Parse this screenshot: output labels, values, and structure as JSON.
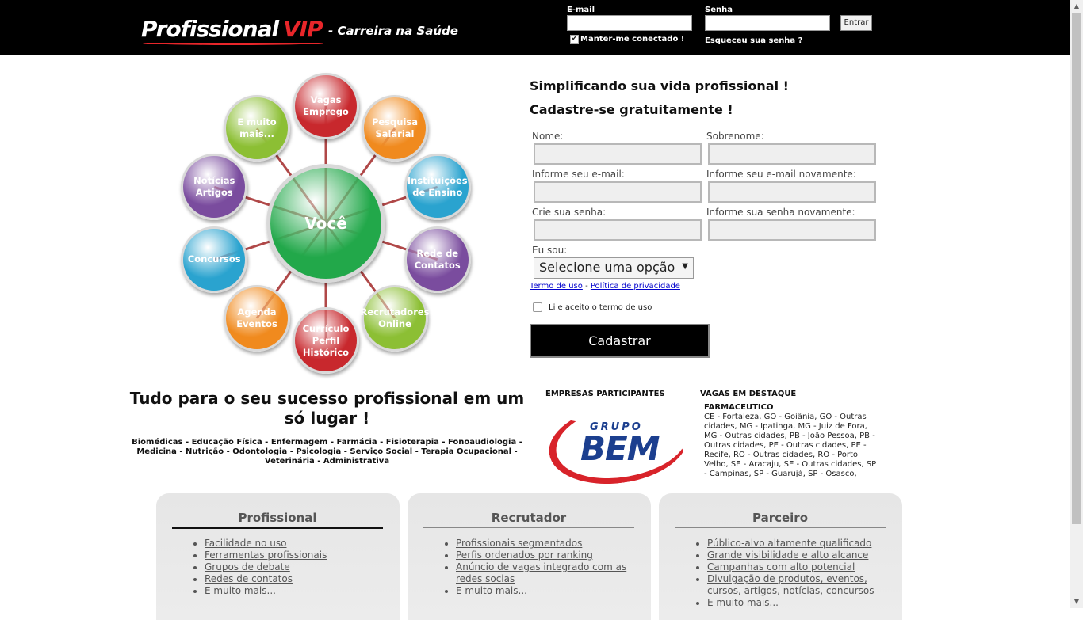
{
  "header": {
    "logo_main": "Profissional",
    "logo_accent": "VIP",
    "tagline": "- Carreira na Saúde",
    "email_label": "E-mail",
    "password_label": "Senha",
    "login_button": "Entrar",
    "keep_connected": "Manter-me conectado !",
    "forgot_password": "Esqueceu sua senha ?"
  },
  "diagram": {
    "center": "Você",
    "nodes": [
      {
        "label": "Vagas\nEmprego",
        "color": "#c8282d"
      },
      {
        "label": "Pesquisa\nSalarial",
        "color": "#f08a1e"
      },
      {
        "label": "Instituições\nde Ensino",
        "color": "#2aa3cf"
      },
      {
        "label": "Rede de\nContatos",
        "color": "#7a4c9e"
      },
      {
        "label": "Recrutadores\nOnline",
        "color": "#8cbf34"
      },
      {
        "label": "Currículo\nPerfil\nHistórico",
        "color": "#c8282d"
      },
      {
        "label": "Agenda\nEventos",
        "color": "#f08a1e"
      },
      {
        "label": "Concursos",
        "color": "#2aa3cf"
      },
      {
        "label": "Notícias\nArtigos",
        "color": "#7a4c9e"
      },
      {
        "label": "E muito\nmais...",
        "color": "#8cbf34"
      }
    ],
    "center_color": "#22a84a",
    "connector_color": "#b04848"
  },
  "registration": {
    "title1": "Simplificando sua vida profissional !",
    "title2": "Cadastre-se gratuitamente !",
    "first_name_label": "Nome:",
    "last_name_label": "Sobrenome:",
    "email_label": "Informe seu e-mail:",
    "email_confirm_label": "Informe seu e-mail novamente:",
    "password_label": "Crie sua senha:",
    "password_confirm_label": "Informe sua senha novamente:",
    "role_label": "Eu sou:",
    "role_select": "Selecione uma opção",
    "terms_link": "Termo de uso",
    "terms_separator": "-",
    "privacy_link": "Política de privacidade",
    "accept_text": "Li e aceito o termo de uso",
    "submit_button": "Cadastrar"
  },
  "promo": {
    "headline": "Tudo para o seu sucesso profissional em um só lugar !",
    "areas": "Biomédicas - Educação Física - Enfermagem - Farmácia - Fisioterapia - Fonoaudiologia - Medicina - Nutrição - Odontologia - Psicologia - Serviço Social - Terapia Ocupacional - Veterinária - Administrativa"
  },
  "companies": {
    "title": "EMPRESAS PARTICIPANTES",
    "logo_top": "GRUPO",
    "logo_main": "BEM"
  },
  "featured_jobs": {
    "title": "VAGAS EM DESTAQUE",
    "job_title": "FARMACEUTICO",
    "locations": "CE - Fortaleza, GO - Goiânia, GO - Outras cidades, MG - Ipatinga, MG - Juiz de Fora, MG - Outras cidades, PB - João Pessoa, PB - Outras cidades, PE - Outras cidades, PE - Recife, RO - Outras cidades, RO - Porto Velho, SE - Aracaju, SE - Outras cidades, SP - Campinas, SP - Guarujá, SP - Osasco,"
  },
  "cards": [
    {
      "title": "Profissional",
      "items": [
        "Facilidade no uso",
        "Ferramentas profissionais",
        "Grupos de debate",
        "Redes de contatos",
        "E muito mais..."
      ]
    },
    {
      "title": "Recrutador",
      "items": [
        "Profissionais segmentados",
        "Perfis ordenados por ranking",
        "Anúncio de vagas integrado com as redes socias",
        "E muito mais..."
      ]
    },
    {
      "title": "Parceiro",
      "items": [
        "Público-alvo altamente qualificado",
        "Grande visibilidade e alto alcance",
        "Campanhas com alto potencial",
        "Divulgação de produtos, eventos, cursos, artigos, notícias, concursos",
        "E muito mais..."
      ]
    }
  ]
}
